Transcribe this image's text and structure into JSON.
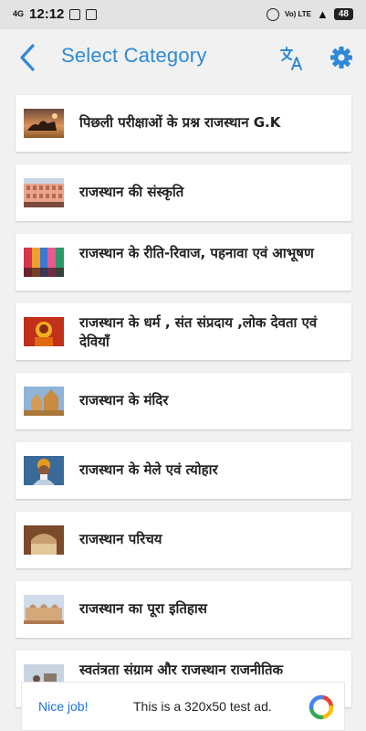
{
  "status_bar": {
    "network": "4G",
    "time": "12:12",
    "volte": "Vo) LTE",
    "battery": "48"
  },
  "app_bar": {
    "title": "Select Category"
  },
  "categories": [
    {
      "label": "पिछली परीक्षाओं के प्रश्न राजस्थान G.K",
      "thumb": "camel-desert"
    },
    {
      "label": "राजस्थान की संस्कृति",
      "thumb": "hawa-mahal"
    },
    {
      "label": "राजस्थान के रीति-रिवाज, पहनावा एवं आभूषण",
      "thumb": "bazaar-textiles"
    },
    {
      "label": "राजस्थान के धर्म , संत संप्रदाय ,लोक देवता एवं देवियाँ",
      "thumb": "goddess-painting"
    },
    {
      "label": "राजस्थान के मंदिर",
      "thumb": "temple"
    },
    {
      "label": "राजस्थान के मेले एवं त्योहार",
      "thumb": "fair-man"
    },
    {
      "label": "राजस्थान परिचय",
      "thumb": "fort-arch"
    },
    {
      "label": "राजस्थान का पूरा इतिहास",
      "thumb": "palace"
    },
    {
      "label": "स्वतंत्रता संग्राम और राजस्थान राजनीतिक",
      "thumb": "freedom"
    }
  ],
  "ad": {
    "cta": "Nice job!",
    "text": "This is a 320x50 test ad."
  },
  "colors": {
    "accent": "#2e8ad8",
    "background": "#f1f1f1"
  }
}
